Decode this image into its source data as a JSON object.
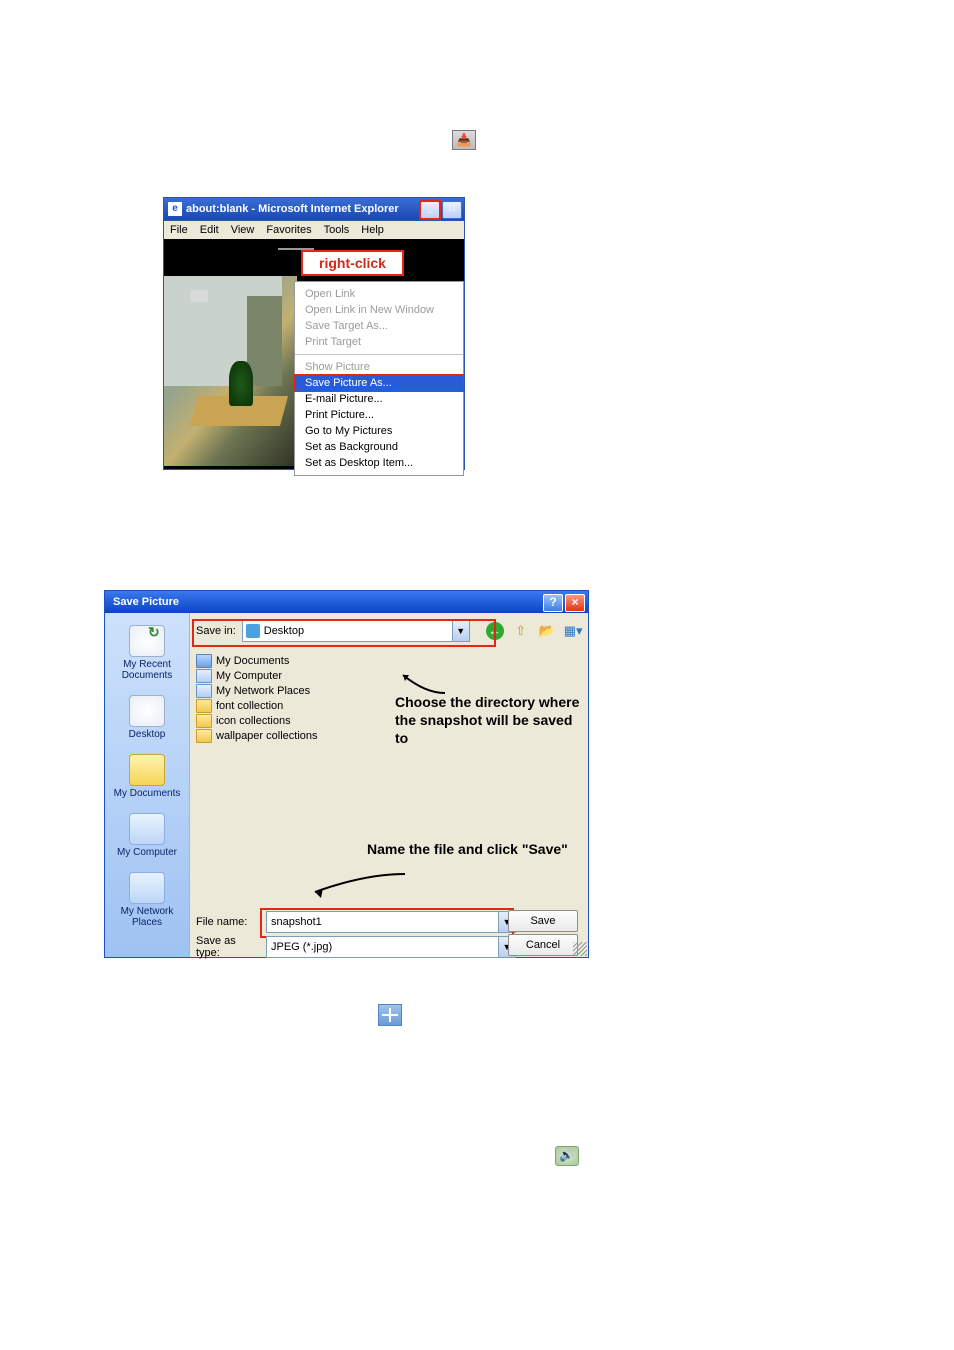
{
  "snapshot_icon": {
    "glyph": "📥"
  },
  "ie_window": {
    "title": "about:blank - Microsoft Internet Explorer",
    "menu": [
      "File",
      "Edit",
      "View",
      "Favorites",
      "Tools",
      "Help"
    ],
    "right_click_label": "right-click",
    "context_menu": {
      "group1": [
        {
          "label": "Open Link",
          "disabled": true
        },
        {
          "label": "Open Link in New Window",
          "disabled": true
        },
        {
          "label": "Save Target As...",
          "disabled": true
        },
        {
          "label": "Print Target",
          "disabled": true
        }
      ],
      "group2": [
        {
          "label": "Show Picture",
          "disabled": true
        },
        {
          "label": "Save Picture As...",
          "selected": true
        },
        {
          "label": "E-mail Picture..."
        },
        {
          "label": "Print Picture..."
        },
        {
          "label": "Go to My Pictures"
        },
        {
          "label": "Set as Background"
        },
        {
          "label": "Set as Desktop Item..."
        }
      ]
    }
  },
  "save_dialog": {
    "title": "Save Picture",
    "save_in_label": "Save in:",
    "save_in_value": "Desktop",
    "places": [
      {
        "label": "My Recent Documents"
      },
      {
        "label": "Desktop"
      },
      {
        "label": "My Documents"
      },
      {
        "label": "My Computer"
      },
      {
        "label": "My Network Places"
      }
    ],
    "listing": [
      {
        "label": "My Documents",
        "icon": "bluefld"
      },
      {
        "label": "My Computer",
        "icon": "comp"
      },
      {
        "label": "My Network Places",
        "icon": "net"
      },
      {
        "label": "font collection",
        "icon": "yfolder"
      },
      {
        "label": "icon collections",
        "icon": "yfolder"
      },
      {
        "label": "wallpaper collections",
        "icon": "yfolder"
      }
    ],
    "annotation_dir": "Choose the directory where the snapshot will be saved to",
    "annotation_name": "Name the file and click \"Save\"",
    "file_name_label": "File name:",
    "file_name_value": "snapshot1",
    "save_type_label": "Save as type:",
    "save_type_value": "JPEG (*.jpg)",
    "save_button": "Save",
    "cancel_button": "Cancel"
  }
}
